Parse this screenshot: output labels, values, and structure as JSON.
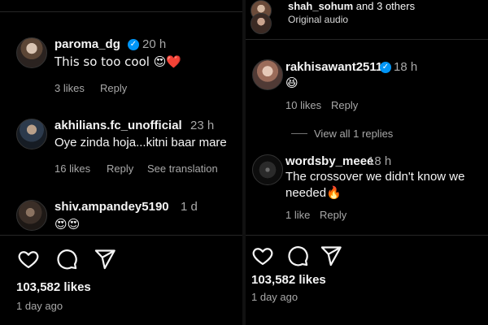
{
  "left": {
    "comments": [
      {
        "username": "paroma_dg",
        "verified": true,
        "time": "20 h",
        "text": "This so too cool 😍❤️",
        "likes": "3 likes",
        "reply": "Reply"
      },
      {
        "username": "akhilians.fc_unofficial",
        "time": "23 h",
        "text": "Oye zinda hoja...kitni baar mare",
        "likes": "16 likes",
        "reply": "Reply",
        "translate": "See translation"
      },
      {
        "username": "shiv.ampandey5190",
        "time": "1 d",
        "text": "😍😍"
      }
    ],
    "likes_count": "103,582 likes",
    "posted": "1 day ago"
  },
  "right": {
    "audio": {
      "line1_user": "shah_sohum",
      "line1_rest": " and 3 others",
      "line2": "Original audio"
    },
    "comments": [
      {
        "username": "rakhisawant2511",
        "verified": true,
        "time": "18 h",
        "text": "😆",
        "likes": "10 likes",
        "reply": "Reply",
        "view_replies": "View all 1 replies"
      },
      {
        "username": "wordsby_meee",
        "time": "18 h",
        "text": "The crossover we didn't know we needed🔥",
        "likes": "1 like",
        "reply": "Reply"
      }
    ],
    "likes_count": "103,582 likes",
    "posted": "1 day ago"
  },
  "colors": {
    "background": "#000000",
    "text": "#f5f5f5",
    "muted": "#a8a8a8",
    "verified": "#0095f6",
    "separator": "#262626"
  },
  "icons": [
    "heart-icon",
    "comment-icon",
    "share-icon",
    "verified-icon"
  ]
}
